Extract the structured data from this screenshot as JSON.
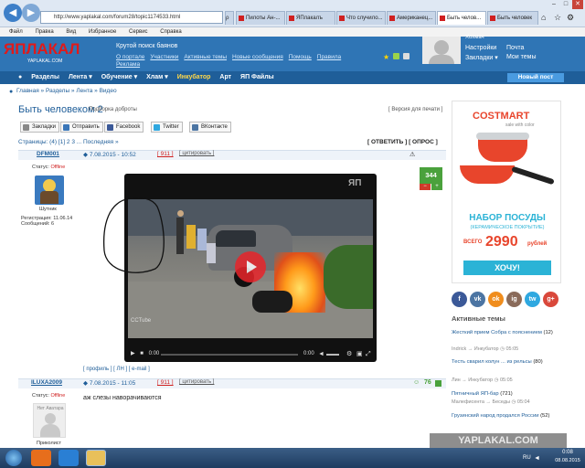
{
  "browser": {
    "address": "http://www.yaplakal.com/forum28/topic1174533.html",
    "tabs": [
      "Пилоты Ан-...",
      "ЯПлакалъ",
      "Что случило...",
      "Американец...",
      "Быть челов...",
      "Быть человек"
    ],
    "menu": [
      "Файл",
      "Правка",
      "Вид",
      "Избранное",
      "Сервис",
      "Справка"
    ]
  },
  "site": {
    "logo": "ЯПЛАКАЛ",
    "logo_sub": "YAPLAKAL.COM",
    "tagline": "Крутой поиск баянов",
    "header_links": [
      "О портале",
      "Участники",
      "Активные темы",
      "Новые сообщения",
      "Помощь",
      "Правила",
      "Реклама"
    ],
    "user": {
      "name": "Хохмач",
      "links": [
        "Настройки",
        "Почта",
        "Закладки ▾",
        "Мои темы"
      ]
    },
    "nav": [
      "Разделы",
      "Лента ▾",
      "Обучение ▾",
      "Хлам ▾",
      "Инкубатор",
      "Арт",
      "ЯП Файлы"
    ],
    "new_post": "Новый пост"
  },
  "breadcrumb": "Главная » Разделы » Лента » Видео",
  "topic": {
    "title": "Быть человеком 2",
    "subtitle": "Подборка доброты",
    "print": "[ Версия для печати ]",
    "share": [
      "Закладки",
      "Отправить",
      "Facebook",
      "Twitter",
      "ВКонтакте"
    ],
    "pages": "Страницы: (4) [1] 2 3 ... Последняя »",
    "actions": "[ ОТВЕТИТЬ ] [ ОПРОС ]"
  },
  "posts": [
    {
      "user": "DFM001",
      "status": "Статус: Offline",
      "rank": "Шутник",
      "reg": "Регистрация: 11.06.14",
      "msgs": "Сообщений: 6",
      "date": "7.08.2015 - 10:52",
      "num": "[ 911 ]",
      "quote": "[ цитировать ]",
      "rating": "344",
      "video": {
        "watermark": "ЯП",
        "source": "CCTube",
        "time": "0:00",
        "time2": "0:00"
      },
      "footer": "[ профиль ] [ ЛН ] [ e-mail ]"
    },
    {
      "user": "ILUXA2009",
      "status": "Статус: Offline",
      "avatar": "Нет Аватара",
      "rank": "Приколист",
      "date": "7.08.2015 - 11:05",
      "num": "[ 911 ]",
      "quote": "[ цитировать ]",
      "rating": "76",
      "text": "аж слезы наворачиваются"
    }
  ],
  "ad": {
    "brand": "COSTMART",
    "brand_sub": "sale with color",
    "headline": "НАБОР ПОСУДЫ",
    "sub": "(КЕРАМИЧЕСКОЕ ПОКРЫТИЕ)",
    "price_prefix": "ВСЕГО",
    "price": "2990",
    "price_unit": "рублей",
    "cta": "ХОЧУ!"
  },
  "social": [
    "f",
    "vk",
    "ok",
    "ig",
    "tw",
    "g+"
  ],
  "active_topics": {
    "title": "Активные темы",
    "items": [
      {
        "title": "Жесткий прием Собра с пояснением",
        "count": "(12)",
        "author": "Indrick",
        "section": "Инкубатор",
        "time": "05:05"
      },
      {
        "title": "Тесть сварил колун ... из рельсы",
        "count": "(80)",
        "author": "Лин",
        "section": "Инкубатор",
        "time": "05:05"
      },
      {
        "title": "Пятничный ЯП-бар",
        "count": "(721)",
        "author": "Малефисента",
        "section": "Беседы",
        "time": "05:04"
      },
      {
        "title": "Грузинский народ продался России",
        "count": "(52)",
        "author": "",
        "section": "",
        "time": ""
      }
    ]
  },
  "taskbar": {
    "lang": "RU",
    "time": "0:08",
    "date": "08.08.2015"
  },
  "watermark": "YAPLAKAL.COM",
  "colors": {
    "header": "#2f75b5",
    "nav": "#1f5e99",
    "accent_red": "#d02020",
    "ad_red": "#e8452c",
    "ad_blue": "#2bb3d6"
  }
}
